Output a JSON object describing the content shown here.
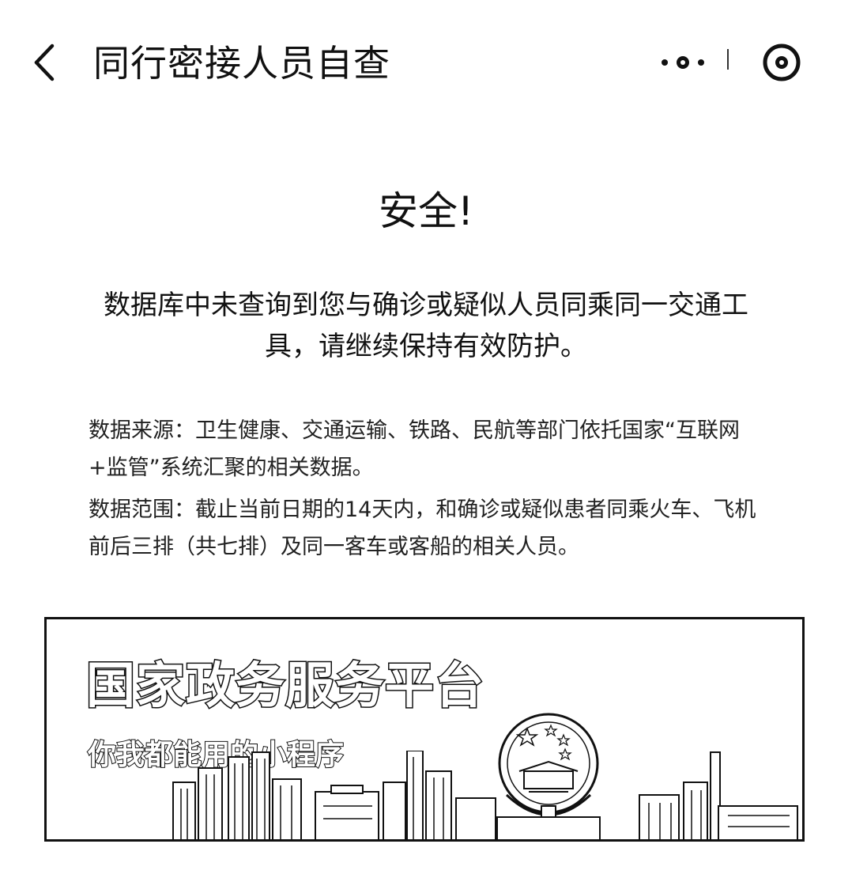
{
  "nav": {
    "title": "同行密接人员自查"
  },
  "result": {
    "heading": "安全!",
    "message": "数据库中未查询到您与确诊或疑似人员同乘同一交通工具，请继续保持有效防护。"
  },
  "info": {
    "source": "数据来源：卫生健康、交通运输、铁路、民航等部门依托国家“互联网+监管”系统汇聚的相关数据。",
    "range": "数据范围：截止当前日期的14天内，和确诊或疑似患者同乘火车、飞机前后三排（共七排）及同一客车或客船的相关人员。"
  },
  "banner": {
    "title": "国家政务服务平台",
    "subtitle": "你我都能用的小程序"
  },
  "icons": [
    "back-arrow-icon",
    "more-dots-icon",
    "close-target-icon",
    "national-emblem-icon",
    "city-skyline"
  ],
  "colors": {
    "text": "#111111",
    "background": "#ffffff"
  }
}
